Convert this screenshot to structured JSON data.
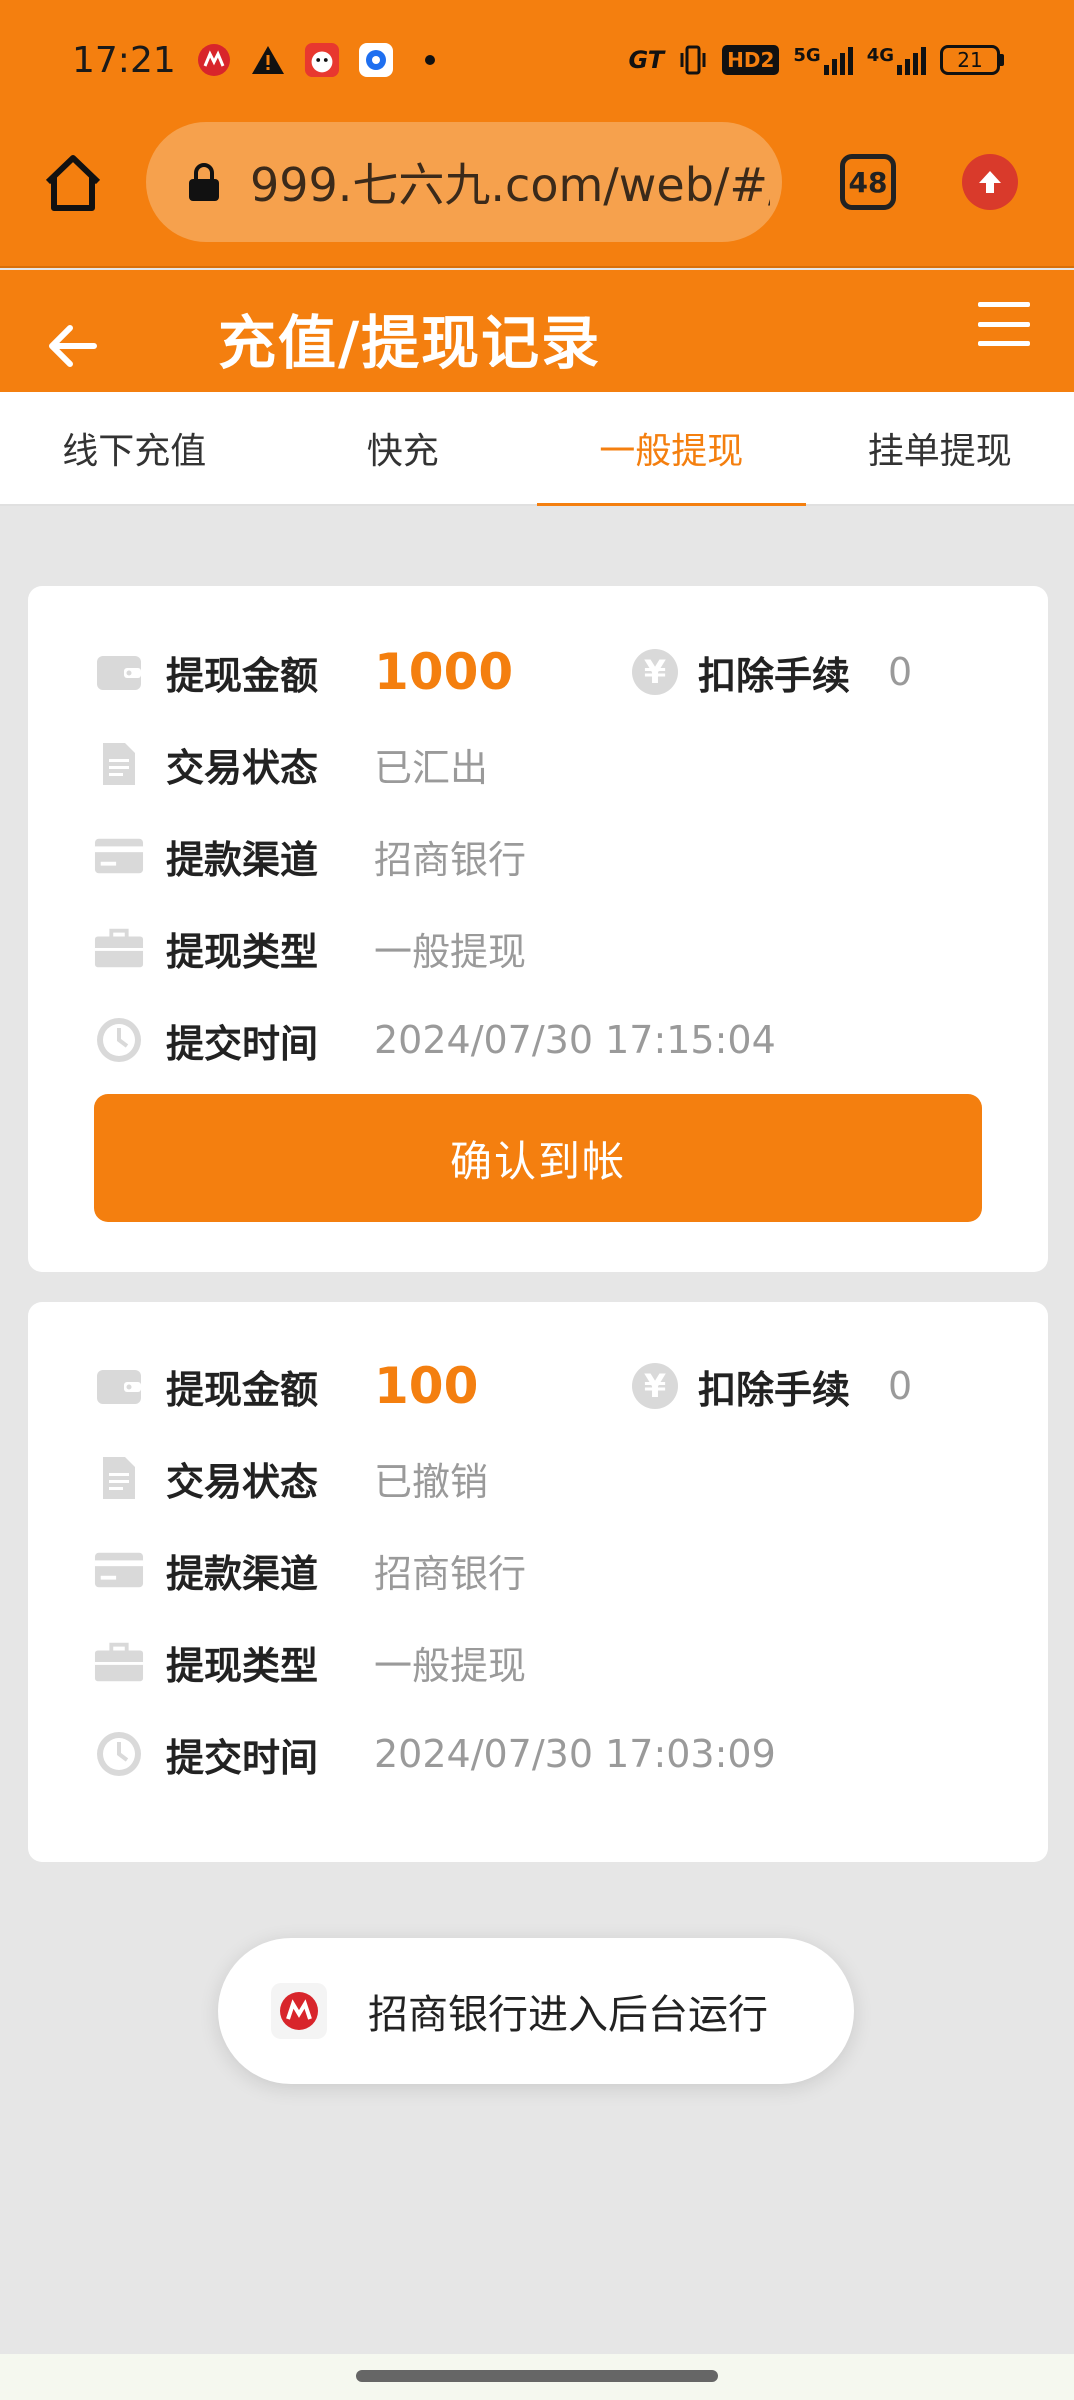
{
  "status_bar": {
    "time": "17:21",
    "icons_left": [
      "cmb-app-icon",
      "warning-icon",
      "mascot-app-icon",
      "browser-app-icon",
      "dot-icon"
    ],
    "network_gt": "GT",
    "hd_label": "HD2",
    "net_5g": "5G",
    "net_4g": "4G",
    "battery": "21"
  },
  "browser": {
    "url": "999.七六九.com/web/#/",
    "tab_count": "48"
  },
  "header": {
    "title": "充值/提现记录"
  },
  "tabs": [
    {
      "label": "线下充值",
      "active": false
    },
    {
      "label": "快充",
      "active": false
    },
    {
      "label": "一般提现",
      "active": true
    },
    {
      "label": "挂单提现",
      "active": false
    }
  ],
  "records": [
    {
      "amount_label": "提现金额",
      "amount": "1000",
      "fee_label": "扣除手续",
      "fee": "0",
      "status_label": "交易状态",
      "status": "已汇出",
      "channel_label": "提款渠道",
      "channel": "招商银行",
      "type_label": "提现类型",
      "type": "一般提现",
      "time_label": "提交时间",
      "time": "2024/07/30 17:15:04",
      "button": "确认到帐"
    },
    {
      "amount_label": "提现金额",
      "amount": "100",
      "fee_label": "扣除手续",
      "fee": "0",
      "status_label": "交易状态",
      "status": "已撤销",
      "channel_label": "提款渠道",
      "channel": "招商银行",
      "type_label": "提现类型",
      "type": "一般提现",
      "time_label": "提交时间",
      "time": "2024/07/30 17:03:09"
    }
  ],
  "toast": {
    "text": "招商银行进入后台运行"
  },
  "yen_symbol": "¥",
  "colors": {
    "accent": "#f47f0f",
    "background": "#e6e6e6",
    "muted_text": "#9a9a9a"
  }
}
